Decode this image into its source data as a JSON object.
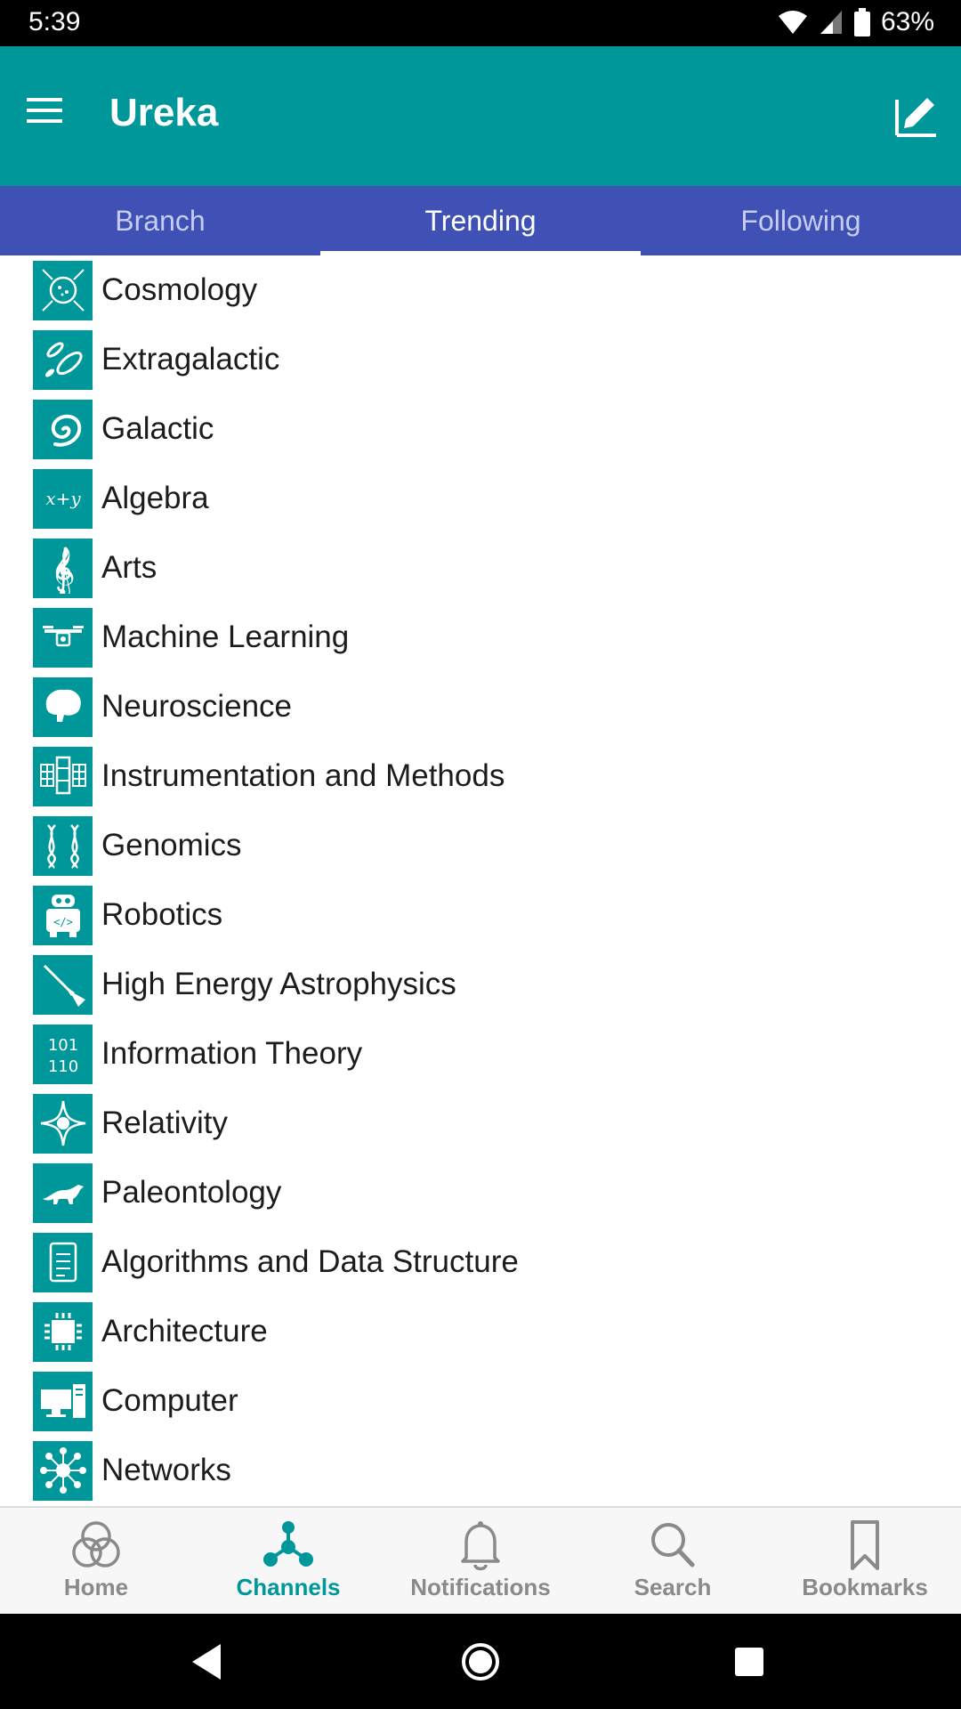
{
  "status_bar": {
    "time": "5:39",
    "battery_percent": "63%"
  },
  "app_bar": {
    "title": "Ureka",
    "menu_icon": "hamburger-menu-icon",
    "action_icon": "edit-icon"
  },
  "tabs": [
    {
      "label": "Branch",
      "active": false
    },
    {
      "label": "Trending",
      "active": true
    },
    {
      "label": "Following",
      "active": false
    }
  ],
  "channels": [
    {
      "label": "Cosmology",
      "icon": "cosmology-icon"
    },
    {
      "label": "Extragalactic",
      "icon": "extragalactic-icon"
    },
    {
      "label": "Galactic",
      "icon": "galaxy-spiral-icon"
    },
    {
      "label": "Algebra",
      "icon": "algebra-icon"
    },
    {
      "label": "Arts",
      "icon": "treble-clef-icon"
    },
    {
      "label": "Machine Learning",
      "icon": "drone-icon"
    },
    {
      "label": "Neuroscience",
      "icon": "brain-icon"
    },
    {
      "label": "Instrumentation and Methods",
      "icon": "satellite-panel-icon"
    },
    {
      "label": "Genomics",
      "icon": "dna-icon"
    },
    {
      "label": "Robotics",
      "icon": "robot-icon"
    },
    {
      "label": "High Energy Astrophysics",
      "icon": "telescope-icon"
    },
    {
      "label": "Information Theory",
      "icon": "binary-icon"
    },
    {
      "label": "Relativity",
      "icon": "relativity-icon"
    },
    {
      "label": "Paleontology",
      "icon": "dinosaur-icon"
    },
    {
      "label": "Algorithms and Data Structure",
      "icon": "document-icon"
    },
    {
      "label": "Architecture",
      "icon": "chip-icon"
    },
    {
      "label": "Computer",
      "icon": "computer-icon"
    },
    {
      "label": "Networks",
      "icon": "network-icon"
    }
  ],
  "algebra_icon_text": "x+y",
  "binary_icon_text": {
    "line1": "101",
    "line2": "110"
  },
  "bottom_nav": [
    {
      "label": "Home",
      "icon": "home-rings-icon",
      "active": false
    },
    {
      "label": "Channels",
      "icon": "channels-icon",
      "active": true
    },
    {
      "label": "Notifications",
      "icon": "bell-icon",
      "active": false
    },
    {
      "label": "Search",
      "icon": "search-icon",
      "active": false
    },
    {
      "label": "Bookmarks",
      "icon": "bookmark-icon",
      "active": false
    }
  ],
  "colors": {
    "teal": "#00979a",
    "indigo": "#3f51b5",
    "inactive": "#8a8a8a"
  }
}
